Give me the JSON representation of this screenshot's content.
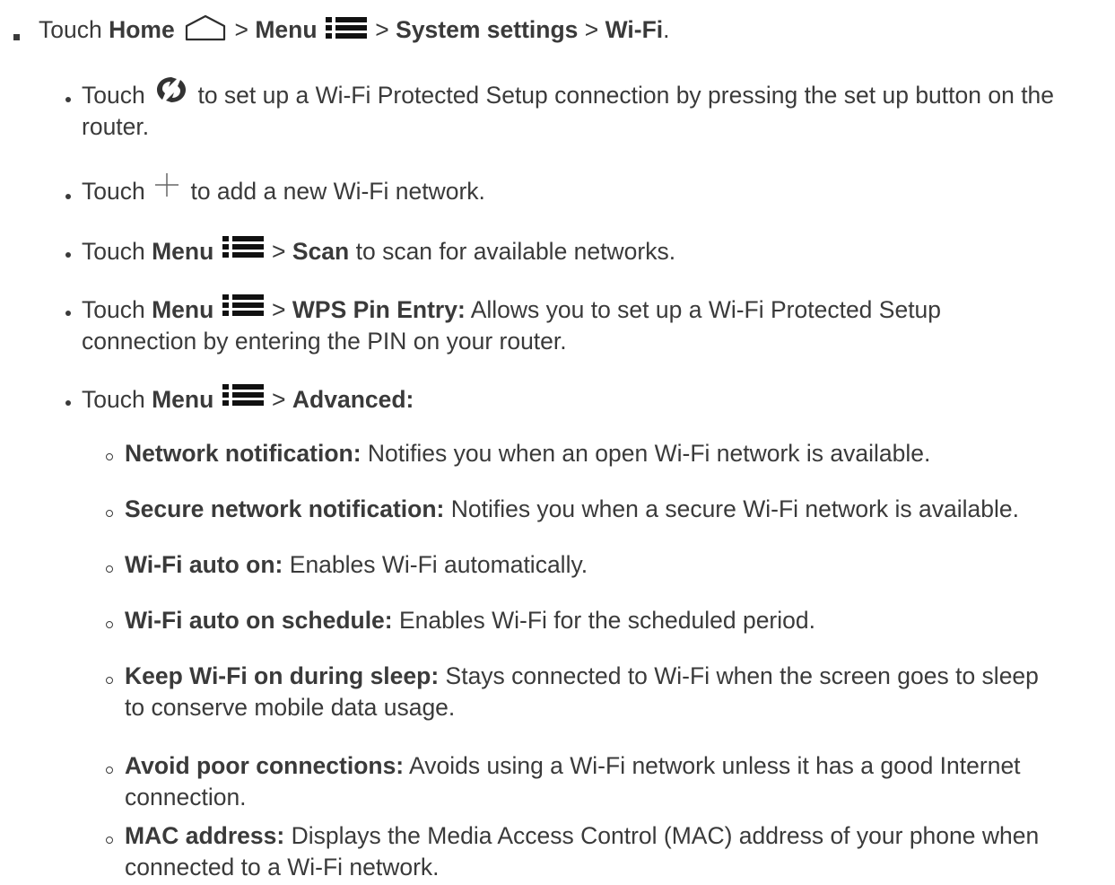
{
  "top_item": {
    "touch": "Touch",
    "home_label": "Home",
    "sep1": ">",
    "menu_label": "Menu",
    "sep2": ">",
    "system_settings_label": "System settings",
    "sep3": ">",
    "wifi_label": "Wi-Fi",
    "period": "."
  },
  "items": [
    {
      "touch": "Touch",
      "text1": "to set up a Wi-Fi Protected Setup connection by pressing the set up button on the",
      "text2": "router."
    },
    {
      "touch": "Touch",
      "text1": "to add a new Wi-Fi network."
    },
    {
      "touch": "Touch",
      "menu_label": "Menu",
      "sep": ">",
      "scan_label": "Scan",
      "text1": "to scan for available networks."
    },
    {
      "touch": "Touch",
      "menu_label": "Menu",
      "sep": ">",
      "wps_label": "WPS Pin Entry:",
      "text1": "Allows you to set up a Wi-Fi Protected Setup",
      "text2": "connection by entering the PIN on your router."
    },
    {
      "touch": "Touch",
      "menu_label": "Menu",
      "sep": ">",
      "advanced_label": "Advanced:"
    }
  ],
  "advanced_items": [
    {
      "term": "Network notification:",
      "desc": "Notifies you when an open Wi-Fi network is available."
    },
    {
      "term": "Secure network notification:",
      "desc": "Notifies you when a secure Wi-Fi network is available."
    },
    {
      "term": "Wi-Fi auto on:",
      "desc": "Enables Wi-Fi automatically."
    },
    {
      "term": "Wi-Fi auto on schedule:",
      "desc": "Enables Wi-Fi for the scheduled period."
    },
    {
      "term": "Keep Wi-Fi on during sleep:",
      "desc": "Stays connected to Wi-Fi when the screen goes to sleep",
      "desc2": "to conserve mobile data usage."
    },
    {
      "term": "Avoid poor connections:",
      "desc": "Avoids using a Wi-Fi network unless it has a good Internet",
      "desc2": "connection."
    },
    {
      "term": "MAC address:",
      "desc": "Displays the Media Access Control (MAC) address of your phone when",
      "desc2": "connected to a Wi-Fi network."
    }
  ],
  "icons": {
    "home": "home-icon",
    "menu": "menu-icon",
    "wps": "wps-icon",
    "add": "plus-icon"
  }
}
